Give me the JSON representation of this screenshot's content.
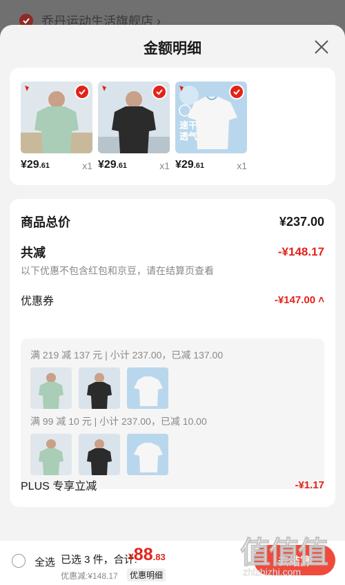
{
  "store": {
    "name": "乔丹运动生活旗舰店 ›"
  },
  "sheet": {
    "title": "金额明细"
  },
  "products": [
    {
      "price_int": "¥29",
      "price_dec": ".61",
      "qty": "x1",
      "shirt_color": "#a9cdb6",
      "bg": "#dfe7ec",
      "badge": ""
    },
    {
      "price_int": "¥29",
      "price_dec": ".61",
      "qty": "x1",
      "shirt_color": "#2b2b2b",
      "bg": "#d9e3ec",
      "badge": ""
    },
    {
      "price_int": "¥29",
      "price_dec": ".61",
      "qty": "x1",
      "shirt_color": "#f6f6f6",
      "bg": "#b9d7ec",
      "badge": "速干\n透气"
    }
  ],
  "summary": {
    "total_label": "商品总价",
    "total_value": "¥237.00",
    "reduce_label": "共减",
    "reduce_value": "-¥148.17",
    "reduce_note": "以下优惠不包含红包和京豆，请在结算页查看",
    "coupon_label": "优惠券",
    "coupon_value": "-¥147.00 ˄",
    "coupon_lines": [
      "满 219 减 137 元 | 小计 237.00，已减 137.00",
      "满 99 减 10 元 | 小计 237.00，已减 10.00"
    ],
    "plus_label": "PLUS 专享立减",
    "plus_value": "-¥1.17"
  },
  "bottom": {
    "select_all": "全选",
    "selected_info": "已选 3 件，合计:",
    "total_currency": "¥",
    "total_int": "88",
    "total_dec": ".83",
    "discount": "优惠减:¥148.17",
    "detail_link": "优惠明细",
    "checkout": "去结算"
  },
  "watermark": {
    "chars": "值值值",
    "url": "zhizhizhi.com"
  },
  "colors": {
    "accent": "#e2231a",
    "checkout": "#f04a3c"
  }
}
